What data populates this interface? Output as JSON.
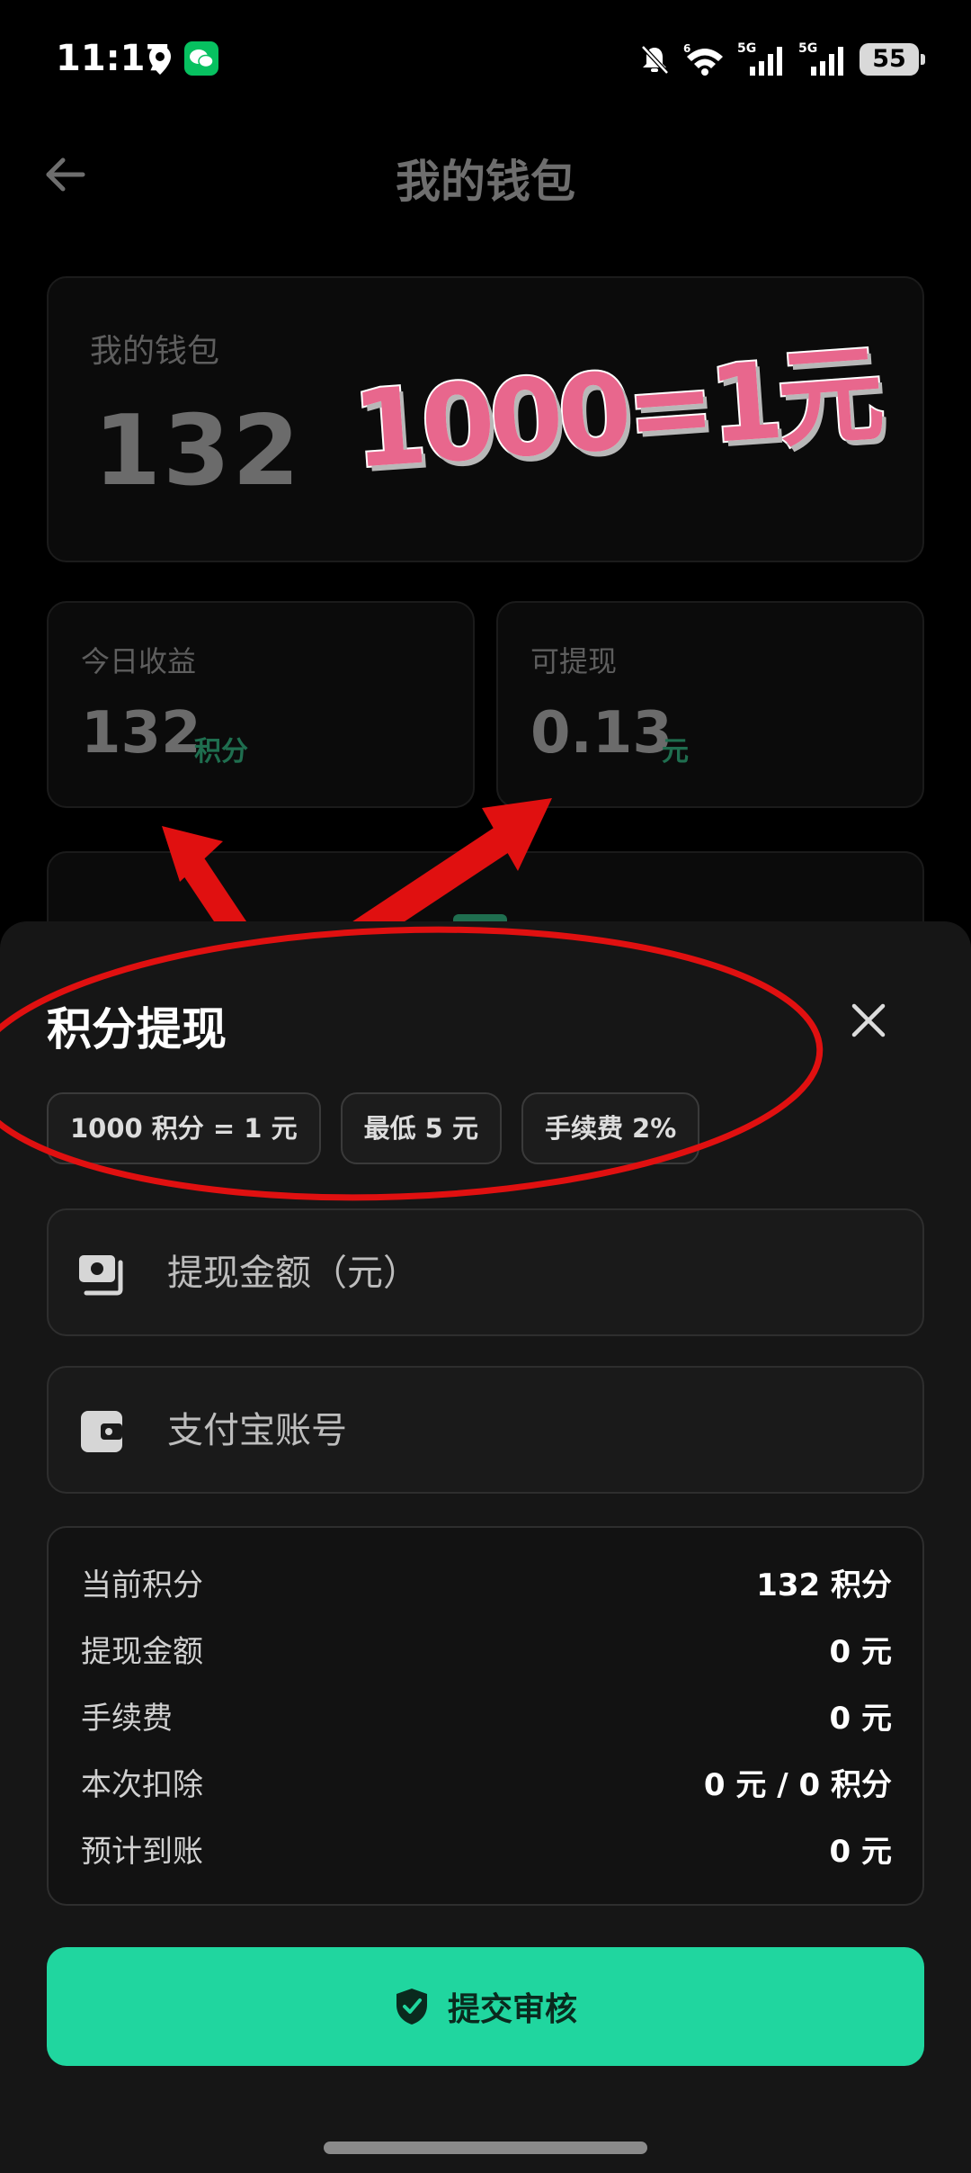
{
  "status_bar": {
    "time": "11:17",
    "network_1": "5G",
    "network_2": "5G",
    "wifi_sup": "6",
    "battery": "55"
  },
  "header": {
    "title": "我的钱包"
  },
  "wallet_card": {
    "label": "我的钱包",
    "value": "132",
    "sticker": "1000=1元"
  },
  "stats": {
    "today_label": "今日收益",
    "today_value": "132",
    "today_unit": "积分",
    "withdrawable_label": "可提现",
    "withdrawable_value": "0.13",
    "withdrawable_unit": "元"
  },
  "sheet": {
    "title": "积分提现",
    "chips": [
      "1000 积分 = 1 元",
      "最低 5 元",
      "手续费 2%"
    ],
    "amount_placeholder": "提现金额（元）",
    "alipay_placeholder": "支付宝账号",
    "summary": [
      {
        "label": "当前积分",
        "value": "132 积分"
      },
      {
        "label": "提现金额",
        "value": "0 元"
      },
      {
        "label": "手续费",
        "value": "0 元"
      },
      {
        "label": "本次扣除",
        "value": "0 元 / 0 积分"
      },
      {
        "label": "预计到账",
        "value": "0 元"
      }
    ],
    "submit_label": "提交审核"
  },
  "colors": {
    "accent": "#20d69f",
    "annotation_red": "#e01010",
    "sticker_pink": "#e8678d"
  },
  "icons": [
    "back-arrow-icon",
    "location-icon",
    "wechat-icon",
    "mute-bell-icon",
    "wifi-icon",
    "signal-icon",
    "close-icon",
    "wallet-cash-icon",
    "wallet-card-icon",
    "shield-check-icon"
  ]
}
